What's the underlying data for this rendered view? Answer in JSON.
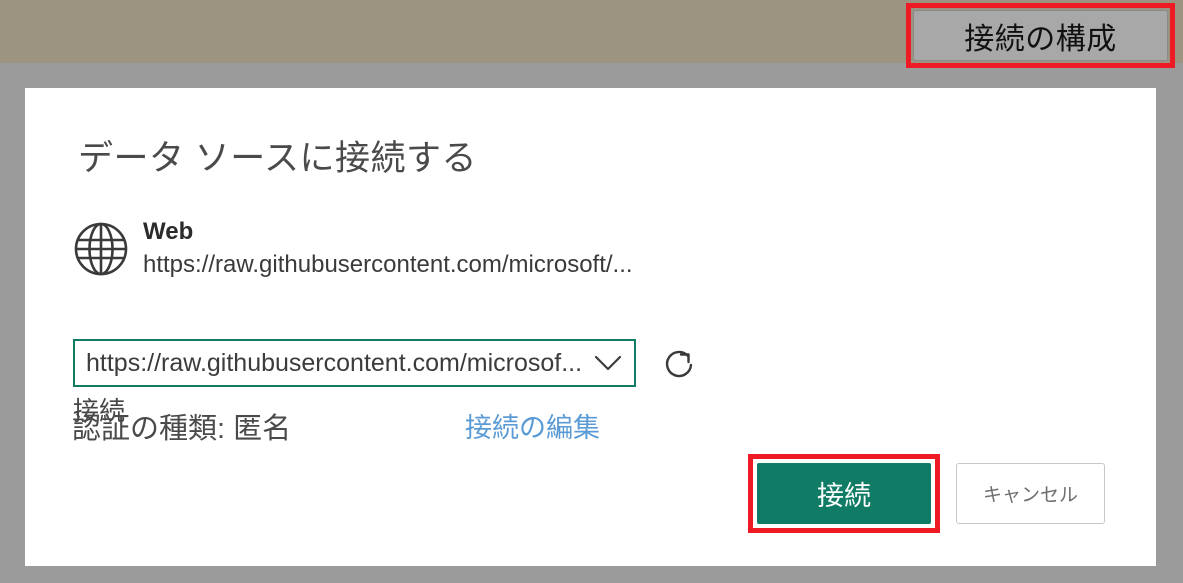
{
  "window": {
    "background_color": "#9b9b9b",
    "top_band_color": "#9c9480"
  },
  "top_toolbar": {
    "configure_connection_label": "接続の構成",
    "highlight_color": "#ee1b24"
  },
  "dialog": {
    "title": "データ ソースに接続する",
    "source": {
      "icon": "globe-icon",
      "name": "Web",
      "url": "https://raw.githubusercontent.com/microsoft/..."
    },
    "connection": {
      "label": "接続",
      "selected_value": "https://raw.githubusercontent.com/microsof...",
      "dropdown_icon": "chevron-down-icon",
      "refresh_icon": "refresh-icon",
      "border_color": "#107c65"
    },
    "authentication": {
      "text": "認証の種類: 匿名",
      "edit_link_label": "接続の編集",
      "edit_link_color": "#5b9bd5"
    },
    "footer": {
      "connect_label": "接続",
      "cancel_label": "キャンセル",
      "connect_color": "#107c65",
      "connect_highlight_color": "#ee1b24"
    }
  }
}
